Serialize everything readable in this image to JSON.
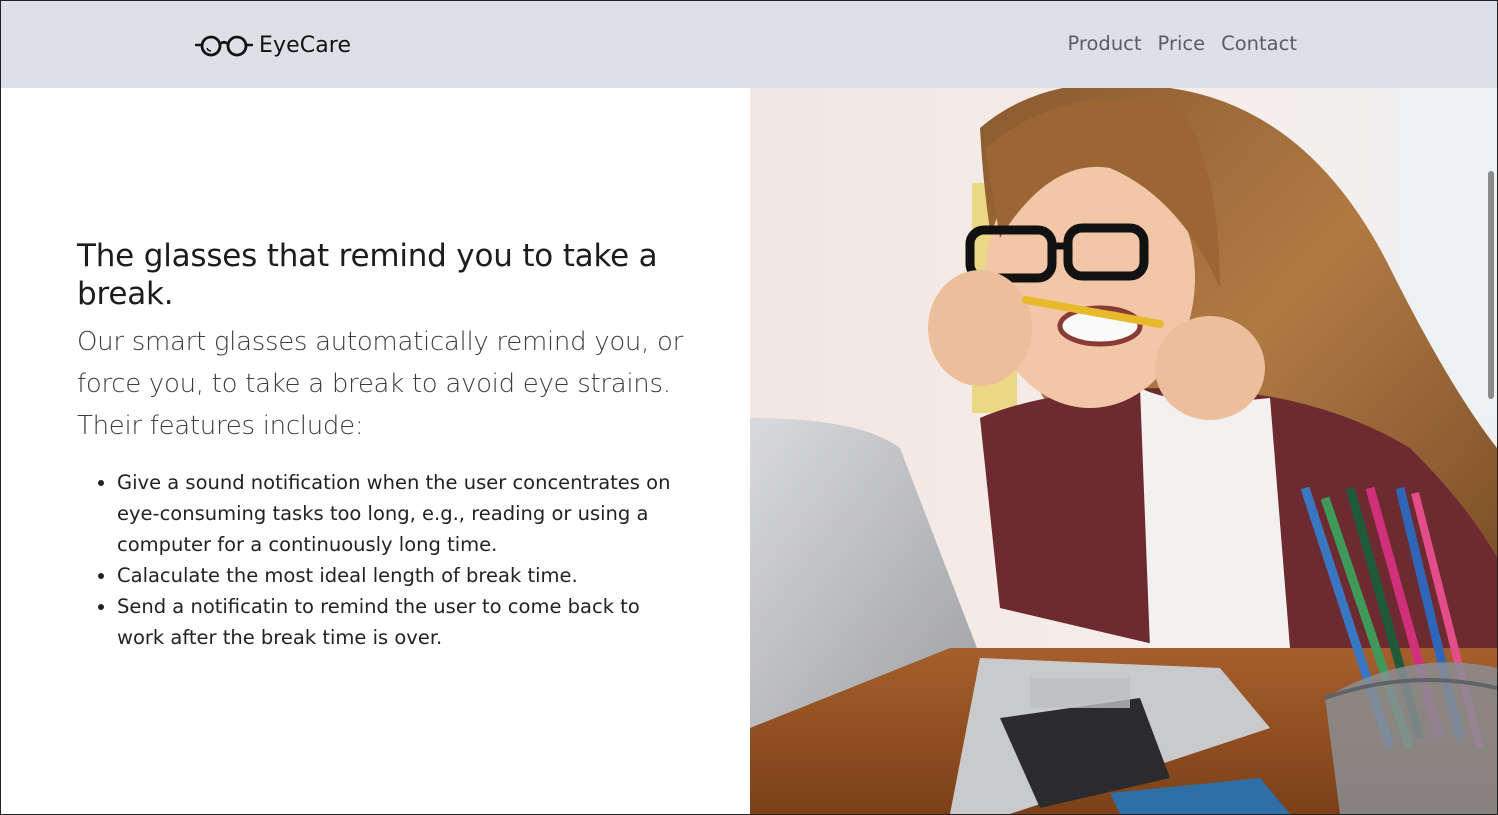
{
  "brand": {
    "name": "EyeCare",
    "logo_icon": "glasses-icon"
  },
  "nav": {
    "items": [
      {
        "label": "Product"
      },
      {
        "label": "Price"
      },
      {
        "label": "Contact"
      }
    ]
  },
  "hero": {
    "headline": "The glasses that remind you to take a break.",
    "lead": "Our smart glasses automatically remind you, or force you, to take a break to avoid eye strains. Their features include:",
    "features": [
      "Give a sound notification when the user concentrates on eye-consuming tasks too long, e.g., reading or using a computer for a continuously long time.",
      "Calaculate the most ideal length of break time.",
      "Send a notificatin to remind the user to come back to work after the break time is over."
    ]
  },
  "colors": {
    "navbar_bg": "#dde1e6",
    "nav_link": "#5a5d61",
    "text": "#222222"
  }
}
